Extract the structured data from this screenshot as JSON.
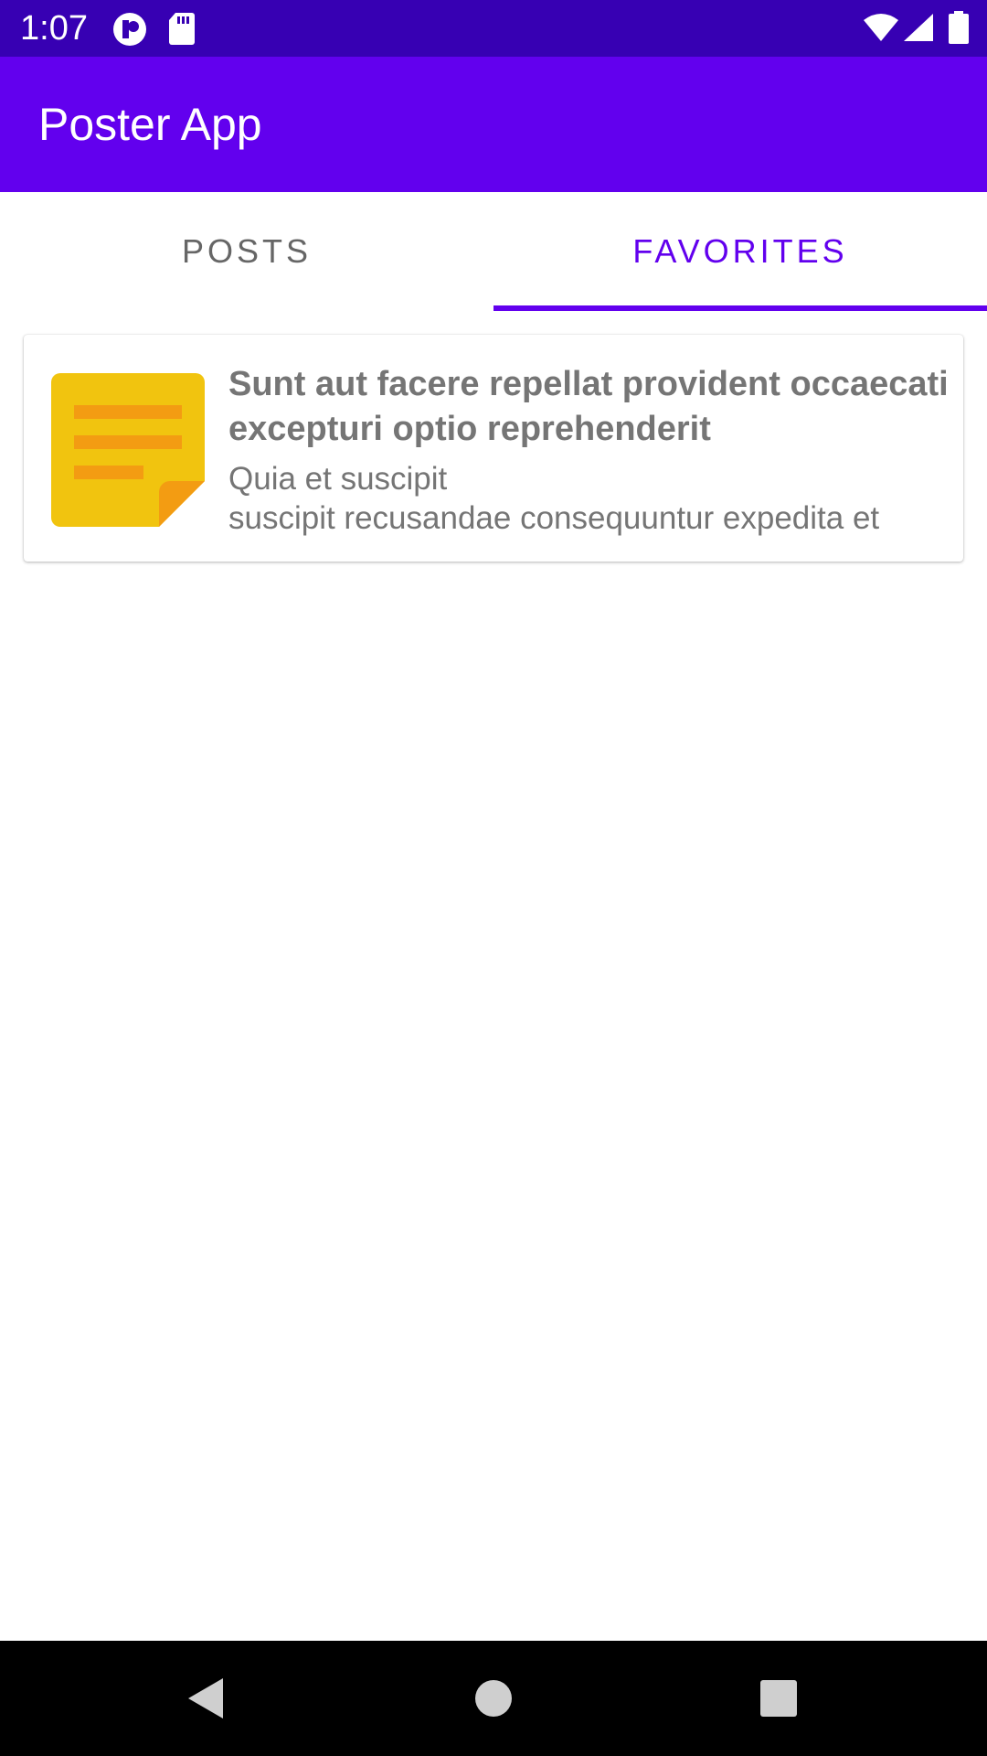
{
  "status_bar": {
    "time": "1:07",
    "icons": [
      "cast-icon",
      "sd-card-icon",
      "wifi-icon",
      "cell-signal-icon",
      "battery-icon"
    ],
    "background": "#3700b3"
  },
  "app_bar": {
    "title": "Poster App",
    "background": "#6200ee"
  },
  "tabs": [
    {
      "label": "POSTS",
      "selected": false
    },
    {
      "label": "FAVORITES",
      "selected": true
    }
  ],
  "accent_color": "#6200ee",
  "favorites": [
    {
      "icon": "sticky-note-icon",
      "title": "Sunt aut facere repellat provident occaecati excepturi optio reprehenderit",
      "body_lines": [
        "Quia et suscipit",
        "suscipit recusandae consequuntur expedita et"
      ]
    }
  ],
  "nav_bar": {
    "buttons": [
      "back-icon",
      "home-icon",
      "recents-icon"
    ]
  }
}
